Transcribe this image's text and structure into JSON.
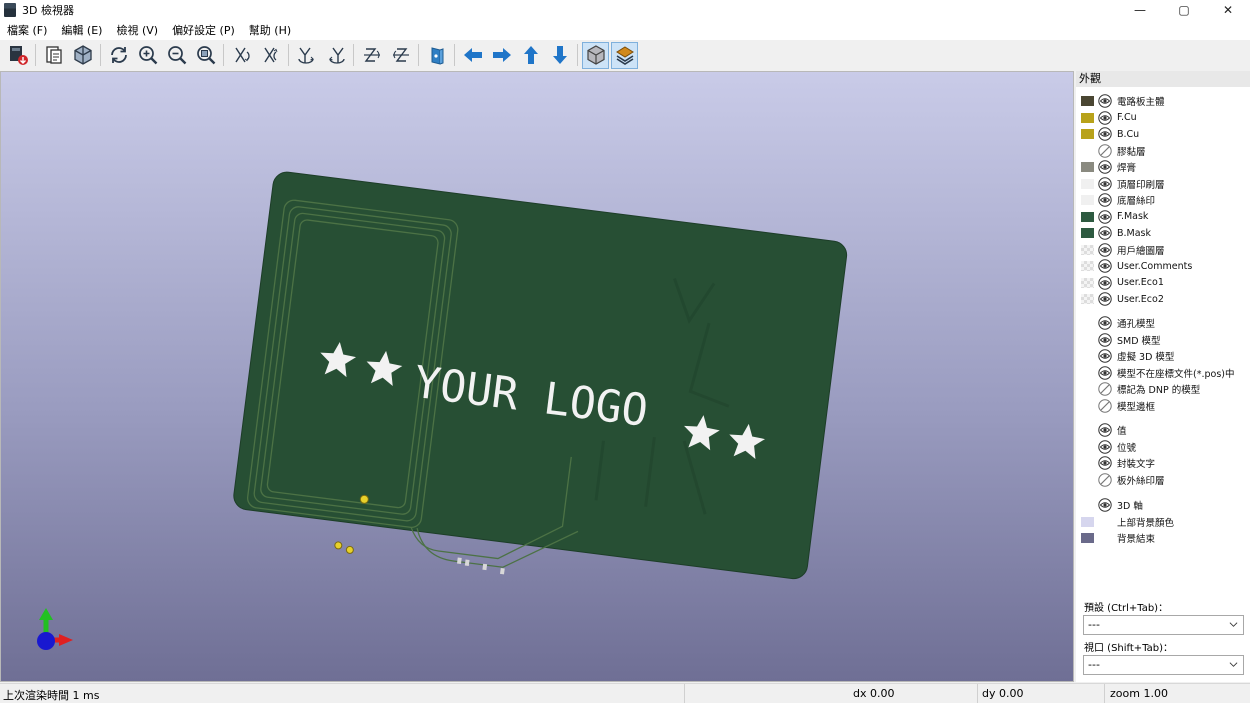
{
  "window": {
    "title": "3D 檢視器",
    "controls": [
      "—",
      "▢",
      "✕"
    ]
  },
  "menu": [
    "檔案 (F)",
    "編輯 (E)",
    "檢視 (V)",
    "偏好設定 (P)",
    "幫助 (H)"
  ],
  "toolbar": {
    "tools": [
      "export-image-icon",
      "copy-clipboard-icon",
      "view-3d-icon",
      "reload-icon",
      "zoom-in-icon",
      "zoom-out-icon",
      "zoom-fit-icon",
      "rotate-x-cw-icon",
      "rotate-x-ccw-icon",
      "rotate-y-cw-icon",
      "rotate-y-ccw-icon",
      "rotate-z-cw-icon",
      "rotate-z-ccw-icon",
      "flip-board-icon",
      "pan-left-icon",
      "pan-right-icon",
      "pan-up-icon",
      "pan-down-icon",
      "ortho-projection-icon",
      "layers-manager-icon"
    ]
  },
  "board": {
    "logo_text": "YOUR LOGO",
    "board_color": "#274f34",
    "silk_color": "#f2f2f2"
  },
  "panel": {
    "header": "外觀",
    "layers": [
      {
        "label": "電路板主體",
        "swatch": "#4a4632",
        "swatch_type": "solid",
        "visibility": "eye"
      },
      {
        "label": "F.Cu",
        "swatch": "#b8a21a",
        "swatch_type": "solid",
        "visibility": "eye"
      },
      {
        "label": "B.Cu",
        "swatch": "#b8a21a",
        "swatch_type": "solid",
        "visibility": "eye"
      },
      {
        "label": "膠黏層",
        "swatch": "",
        "swatch_type": "none",
        "visibility": "hidden"
      },
      {
        "label": "焊膏",
        "swatch": "#8a8a80",
        "swatch_type": "solid",
        "visibility": "eye"
      },
      {
        "label": "頂層印刷層",
        "swatch": "#f0f0f0",
        "swatch_type": "solid",
        "visibility": "eye"
      },
      {
        "label": "底層絲印",
        "swatch": "#f0f0f0",
        "swatch_type": "solid",
        "visibility": "eye"
      },
      {
        "label": "F.Mask",
        "swatch": "#2d5a40",
        "swatch_type": "solid",
        "visibility": "eye"
      },
      {
        "label": "B.Mask",
        "swatch": "#2d5a40",
        "swatch_type": "solid",
        "visibility": "eye"
      },
      {
        "label": "用戶繪圖層",
        "swatch": "",
        "swatch_type": "check",
        "visibility": "eye"
      },
      {
        "label": "User.Comments",
        "swatch": "",
        "swatch_type": "check",
        "visibility": "eye"
      },
      {
        "label": "User.Eco1",
        "swatch": "",
        "swatch_type": "check",
        "visibility": "eye"
      },
      {
        "label": "User.Eco2",
        "swatch": "",
        "swatch_type": "check",
        "visibility": "eye"
      }
    ],
    "models": [
      {
        "label": "通孔模型",
        "visibility": "eye"
      },
      {
        "label": "SMD 模型",
        "visibility": "eye"
      },
      {
        "label": "虛擬 3D 模型",
        "visibility": "eye"
      },
      {
        "label": "模型不在座標文件(*.pos)中",
        "visibility": "eye"
      },
      {
        "label": "標記為 DNP 的模型",
        "visibility": "hidden"
      },
      {
        "label": "模型邊框",
        "visibility": "hidden"
      }
    ],
    "texts": [
      {
        "label": "值",
        "visibility": "eye"
      },
      {
        "label": "位號",
        "visibility": "eye"
      },
      {
        "label": "封裝文字",
        "visibility": "eye"
      },
      {
        "label": "板外絲印層",
        "visibility": "hidden"
      }
    ],
    "extras": [
      {
        "label": "3D 軸",
        "swatch": "",
        "visibility": "eye"
      },
      {
        "label": "上部背景顏色",
        "swatch": "#d6d6ee",
        "visibility": "none"
      },
      {
        "label": "背景結束",
        "swatch": "#6a6a8a",
        "visibility": "none"
      }
    ],
    "preset_label": "預設 (Ctrl+Tab)：",
    "preset_value": "---",
    "viewport_label": "視口 (Shift+Tab)：",
    "viewport_value": "---"
  },
  "status": {
    "render_time": "上次渲染時間 1 ms",
    "dx": "dx 0.00",
    "dy": "dy 0.00",
    "zoom": "zoom 1.00"
  }
}
